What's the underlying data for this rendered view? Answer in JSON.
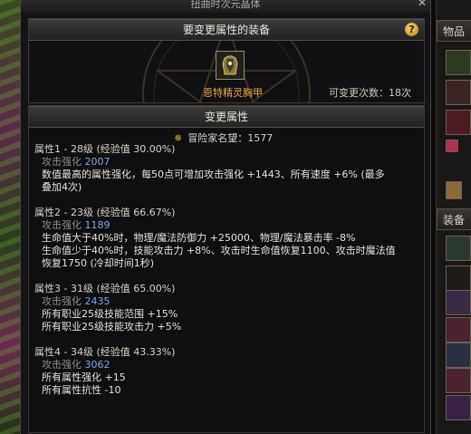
{
  "window": {
    "title": "扭曲时次元晶体",
    "close_glyph": "✕"
  },
  "equipment_section": {
    "header": "要变更属性的装备",
    "help_glyph": "?",
    "item_name": "恩特精灵胸甲",
    "change_count_label": "可变更次数：18次"
  },
  "change_section": {
    "header": "变更属性",
    "reputation_label": "冒险家名望：1577",
    "reputation_icon": "crest-icon"
  },
  "attributes": [
    {
      "head": "属性1 - 28级 (经验值 30.00%)",
      "sub_label": "攻击强化 ",
      "sub_value": "2007",
      "desc": [
        "数值最高的属性强化，每50点可增加攻击强化 +1443、所有速度 +6% (最多",
        "叠加4次)"
      ]
    },
    {
      "head": "属性2 - 23级 (经验值 66.67%)",
      "sub_label": "攻击强化 ",
      "sub_value": "1189",
      "desc": [
        "生命值大于40%时，物理/魔法防御力 +25000、物理/魔法暴击率 -8%",
        "生命值少于40%时，技能攻击力 +8%、攻击时生命值恢复1100、攻击时魔法值",
        "恢复1750 (冷却时间1秒)"
      ]
    },
    {
      "head": "属性3 - 31级 (经验值 65.00%)",
      "sub_label": "攻击强化 ",
      "sub_value": "2435",
      "desc": [
        "所有职业25级技能范围 +15%",
        "所有职业25级技能攻击力 +5%"
      ]
    },
    {
      "head": "属性4 - 34级 (经验值 43.33%)",
      "sub_label": "攻击强化 ",
      "sub_value": "3062",
      "desc": [
        "所有属性强化 +15",
        "所有属性抗性 -10"
      ]
    }
  ],
  "right_panel": {
    "tab_items": "物品",
    "tab_equip": "装备"
  }
}
